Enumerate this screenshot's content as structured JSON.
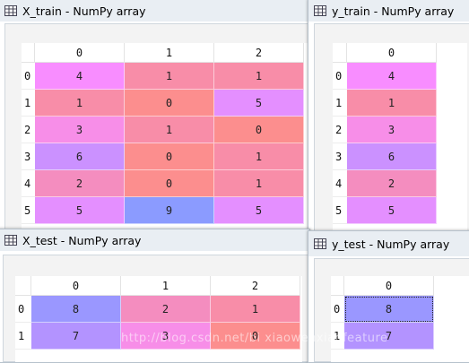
{
  "colors": {
    "cell_1": "#f88da8",
    "cell_2": "#f48dbf",
    "cell_3": "#f78ee8",
    "cell_4": "#f88dff",
    "cell_5": "#e48fff",
    "cell_6": "#cb91ff",
    "cell_7": "#b393ff",
    "cell_8": "#9a97ff",
    "cell_9": "#8b9bff",
    "cell_0": "#fc8e8e"
  },
  "windows": {
    "x_train": {
      "title": "X_train - NumPy array",
      "icon": "table-icon",
      "columns": [
        "0",
        "1",
        "2"
      ],
      "rows": [
        {
          "index": "0",
          "values": [
            "4",
            "1",
            "1"
          ]
        },
        {
          "index": "1",
          "values": [
            "1",
            "0",
            "5"
          ]
        },
        {
          "index": "2",
          "values": [
            "3",
            "1",
            "0"
          ]
        },
        {
          "index": "3",
          "values": [
            "6",
            "0",
            "1"
          ]
        },
        {
          "index": "4",
          "values": [
            "2",
            "0",
            "1"
          ]
        },
        {
          "index": "5",
          "values": [
            "5",
            "9",
            "5"
          ]
        }
      ]
    },
    "y_train": {
      "title": "y_train - NumPy array",
      "icon": "table-icon",
      "columns": [
        "0"
      ],
      "rows": [
        {
          "index": "0",
          "values": [
            "4"
          ]
        },
        {
          "index": "1",
          "values": [
            "1"
          ]
        },
        {
          "index": "2",
          "values": [
            "3"
          ]
        },
        {
          "index": "3",
          "values": [
            "6"
          ]
        },
        {
          "index": "4",
          "values": [
            "2"
          ]
        },
        {
          "index": "5",
          "values": [
            "5"
          ]
        }
      ]
    },
    "x_test": {
      "title": "X_test - NumPy array",
      "icon": "table-icon",
      "columns": [
        "0",
        "1",
        "2"
      ],
      "rows": [
        {
          "index": "0",
          "values": [
            "8",
            "2",
            "1"
          ]
        },
        {
          "index": "1",
          "values": [
            "7",
            "3",
            "0"
          ]
        }
      ]
    },
    "y_test": {
      "title": "y_test - NumPy array",
      "icon": "table-icon",
      "columns": [
        "0"
      ],
      "rows": [
        {
          "index": "0",
          "values": [
            "8"
          ]
        },
        {
          "index": "1",
          "values": [
            "7"
          ]
        }
      ]
    }
  },
  "watermark": "http://blog.csdn.net/bi xiaowenxiaofeature"
}
